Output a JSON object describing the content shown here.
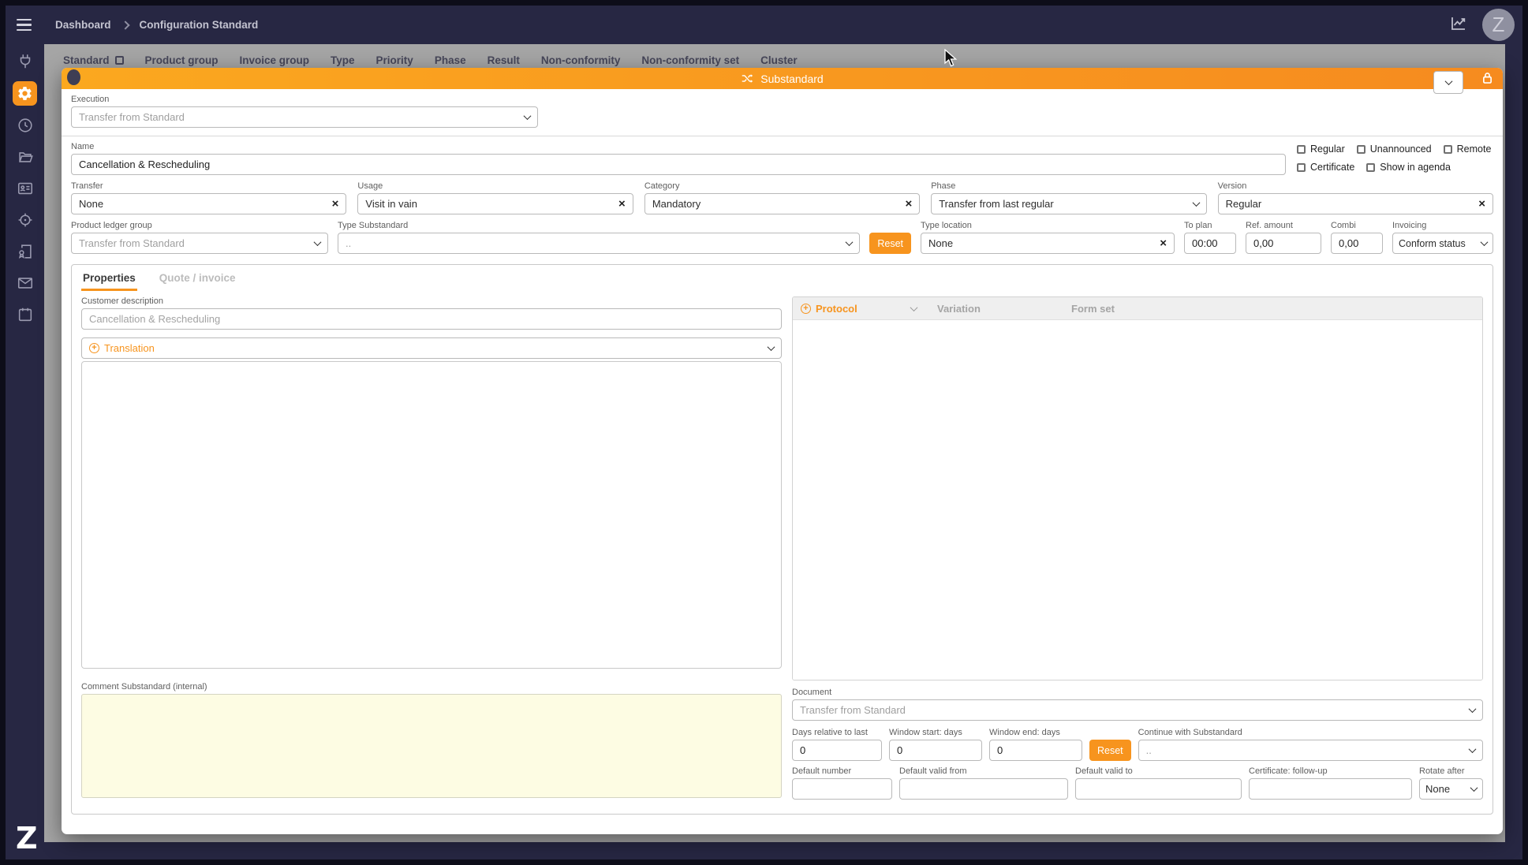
{
  "topbar": {
    "breadcrumb": {
      "home": "Dashboard",
      "current": "Configuration Standard"
    },
    "avatar_letter": "Z"
  },
  "sidebar": {
    "icons": [
      "plug-icon",
      "gear-icon",
      "clock-icon",
      "folder-icon",
      "contact-card-icon",
      "target-icon",
      "certificate-doc-icon",
      "mail-icon",
      "calendar-icon"
    ],
    "active_icon": "gear-icon"
  },
  "background_page": {
    "tabs": [
      "Standard",
      "Product group",
      "Invoice group",
      "Type",
      "Priority",
      "Phase",
      "Result",
      "Non-conformity",
      "Non-conformity set",
      "Cluster"
    ]
  },
  "modal": {
    "title": "Substandard",
    "execution": {
      "label": "Execution",
      "value": "Transfer from Standard"
    },
    "name": {
      "label": "Name",
      "value": "Cancellation & Rescheduling"
    },
    "checkboxes": [
      "Regular",
      "Unannounced",
      "Remote",
      "Certificate",
      "Show in agenda"
    ],
    "fields": {
      "transfer": {
        "label": "Transfer",
        "value": "None"
      },
      "usage": {
        "label": "Usage",
        "value": "Visit in vain"
      },
      "category": {
        "label": "Category",
        "value": "Mandatory"
      },
      "phase": {
        "label": "Phase",
        "value": "Transfer from last regular"
      },
      "version": {
        "label": "Version",
        "value": "Regular"
      },
      "product_ledger_group": {
        "label": "Product ledger group",
        "value": "Transfer from Standard"
      },
      "type_substandard": {
        "label": "Type Substandard",
        "value": ".."
      },
      "reset_label": "Reset",
      "type_location": {
        "label": "Type location",
        "value": "None"
      },
      "to_plan": {
        "label": "To plan",
        "value": "00:00"
      },
      "ref_amount": {
        "label": "Ref. amount",
        "value": "0,00"
      },
      "combi": {
        "label": "Combi",
        "value": "0,00"
      },
      "invoicing": {
        "label": "Invoicing",
        "value": "Conform status"
      }
    },
    "tabs": {
      "properties": "Properties",
      "quote_invoice": "Quote / invoice"
    },
    "properties": {
      "customer_description": {
        "label": "Customer description",
        "placeholder": "Cancellation & Rescheduling"
      },
      "translation": {
        "label": "Translation"
      },
      "protocol": {
        "label": "Protocol",
        "columns": [
          "Variation",
          "Form set"
        ]
      },
      "comment": {
        "label": "Comment Substandard (internal)",
        "value": ""
      },
      "document": {
        "label": "Document",
        "value": "Transfer from Standard"
      },
      "days_relative_to_last": {
        "label": "Days relative to last",
        "value": "0"
      },
      "window_start_days": {
        "label": "Window start: days",
        "value": "0"
      },
      "window_end_days": {
        "label": "Window end: days",
        "value": "0"
      },
      "reset_label": "Reset",
      "continue_with_substandard": {
        "label": "Continue with Substandard",
        "value": ".."
      },
      "default_number": {
        "label": "Default number",
        "value": ""
      },
      "default_valid_from": {
        "label": "Default valid from",
        "value": ""
      },
      "default_valid_to": {
        "label": "Default valid to",
        "value": ""
      },
      "certificate_follow_up": {
        "label": "Certificate: follow-up",
        "value": ""
      },
      "rotate_after": {
        "label": "Rotate after",
        "value": "None"
      }
    }
  },
  "footer": {
    "logo": "Z"
  },
  "colors": {
    "accent": "#f7941e",
    "navy": "#272743",
    "overlay": "#a5a5a5",
    "comment_bg": "#fdfce3"
  }
}
